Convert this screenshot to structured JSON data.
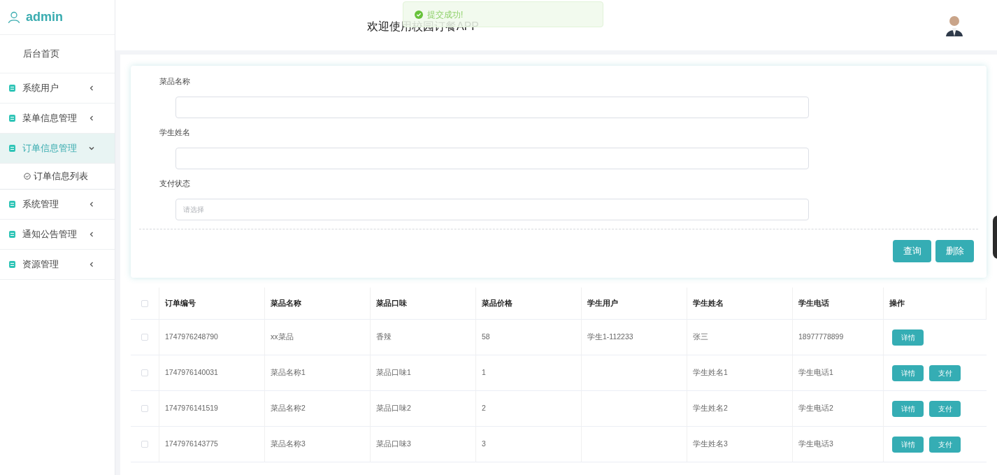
{
  "sidebar": {
    "user": "admin",
    "items": [
      {
        "kind": "link",
        "label": "后台首页",
        "selected": false
      },
      {
        "kind": "group",
        "label": "系统用户",
        "expanded": false,
        "selected": false
      },
      {
        "kind": "group",
        "label": "菜单信息管理",
        "expanded": false,
        "selected": false
      },
      {
        "kind": "group",
        "label": "订单信息管理",
        "expanded": true,
        "selected": true,
        "children": [
          {
            "label": "订单信息列表"
          }
        ]
      },
      {
        "kind": "group",
        "label": "系统管理",
        "expanded": false,
        "selected": false
      },
      {
        "kind": "group",
        "label": "通知公告管理",
        "expanded": false,
        "selected": false
      },
      {
        "kind": "group",
        "label": "资源管理",
        "expanded": false,
        "selected": false
      }
    ]
  },
  "header": {
    "title": "欢迎使用校园订餐APP",
    "toast": "提交成功!"
  },
  "search": {
    "fields": [
      {
        "kind": "text",
        "label": "菜品名称"
      },
      {
        "kind": "text",
        "label": "学生姓名"
      },
      {
        "kind": "select",
        "label": "支付状态",
        "placeholder": "请选择"
      }
    ],
    "buttons": [
      "查询",
      "删除"
    ]
  },
  "table": {
    "all_checked": false,
    "columns": [
      "订单编号",
      "菜品名称",
      "菜品口味",
      "菜品价格",
      "学生用户",
      "学生姓名",
      "学生电话",
      "操作"
    ],
    "rows": [
      {
        "checked": false,
        "cells": [
          "1747976248790",
          "xx菜品",
          "香辣",
          "58",
          "学生1-112233",
          "张三",
          "18977778899"
        ],
        "actions": [
          "详情"
        ]
      },
      {
        "checked": false,
        "cells": [
          "1747976140031",
          "菜品名称1",
          "菜品口味1",
          "1",
          "",
          "学生姓名1",
          "学生电话1"
        ],
        "actions": [
          "详情",
          "支付"
        ]
      },
      {
        "checked": false,
        "cells": [
          "1747976141519",
          "菜品名称2",
          "菜品口味2",
          "2",
          "",
          "学生姓名2",
          "学生电话2"
        ],
        "actions": [
          "详情",
          "支付"
        ]
      },
      {
        "checked": false,
        "cells": [
          "1747976143775",
          "菜品名称3",
          "菜品口味3",
          "3",
          "",
          "学生姓名3",
          "学生电话3"
        ],
        "actions": [
          "详情",
          "支付"
        ]
      }
    ]
  }
}
